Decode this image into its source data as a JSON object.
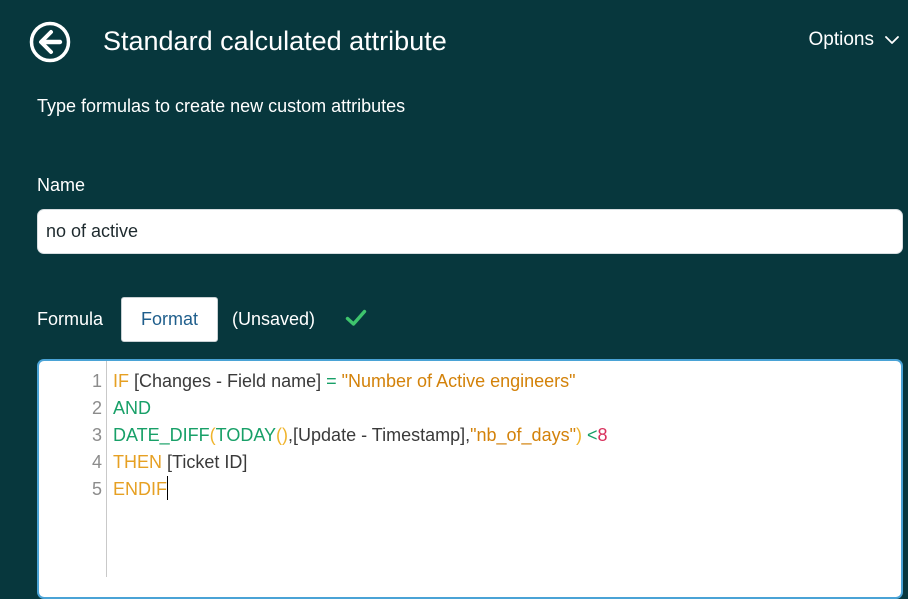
{
  "header": {
    "title": "Standard calculated attribute",
    "back_icon": "back-arrow-circle-icon",
    "options_label": "Options",
    "options_icon": "chevron-down-icon"
  },
  "subtitle": "Type formulas to create new custom attributes",
  "name_field": {
    "label": "Name",
    "value": "no of active"
  },
  "formula": {
    "label": "Formula",
    "format_button_label": "Format",
    "status": "(Unsaved)",
    "status_icon": "check-icon",
    "status_color": "#3ec46d"
  },
  "editor": {
    "lines": [
      {
        "number": "1",
        "tokens": [
          {
            "text": "IF",
            "type": "kw"
          },
          {
            "text": " [Changes - Field name] ",
            "type": "plain"
          },
          {
            "text": "=",
            "type": "fn"
          },
          {
            "text": " ",
            "type": "plain"
          },
          {
            "text": "\"Number of Active engineers\"",
            "type": "str"
          }
        ]
      },
      {
        "number": "2",
        "tokens": [
          {
            "text": "AND",
            "type": "fn"
          }
        ]
      },
      {
        "number": "3",
        "tokens": [
          {
            "text": "DATE_DIFF",
            "type": "fn"
          },
          {
            "text": "(",
            "type": "par"
          },
          {
            "text": "TODAY",
            "type": "fn"
          },
          {
            "text": "()",
            "type": "par"
          },
          {
            "text": ",[Update - Timestamp],",
            "type": "plain"
          },
          {
            "text": "\"nb_of_days\"",
            "type": "str"
          },
          {
            "text": ")",
            "type": "par"
          },
          {
            "text": " ",
            "type": "plain"
          },
          {
            "text": "<",
            "type": "fn"
          },
          {
            "text": "8",
            "type": "num"
          }
        ]
      },
      {
        "number": "4",
        "tokens": [
          {
            "text": "THEN",
            "type": "kw"
          },
          {
            "text": " [Ticket ID]",
            "type": "plain"
          }
        ]
      },
      {
        "number": "5",
        "tokens": [
          {
            "text": "ENDIF",
            "type": "kw"
          }
        ]
      }
    ]
  },
  "colors": {
    "background": "#07373d",
    "accent": "#4aa3d6",
    "format_button_text": "#1f5e8c"
  }
}
